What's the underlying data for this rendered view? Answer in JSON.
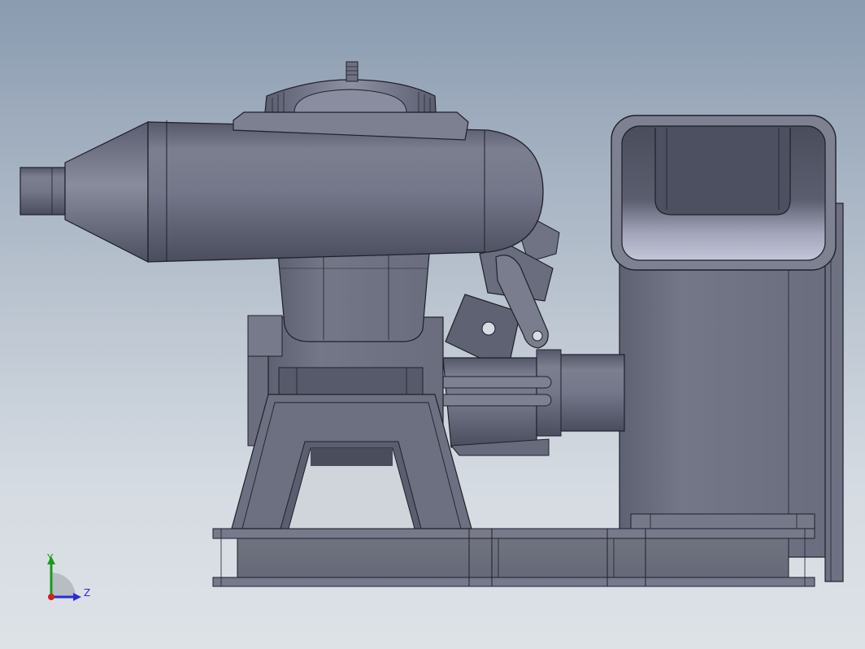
{
  "viewport": {
    "background_top": "#8a9bb0",
    "background_bottom": "#dde2e7"
  },
  "model": {
    "part_color": "#6e7182",
    "edge_color": "#1f2028",
    "shadow_color": "#4e5162",
    "highlight_color": "#b7bacb"
  },
  "triad": {
    "y_label": "Y",
    "z_label": "Z",
    "y_color": "#1a9a1a",
    "z_color": "#2b2bd0",
    "x_color": "#d02020"
  }
}
